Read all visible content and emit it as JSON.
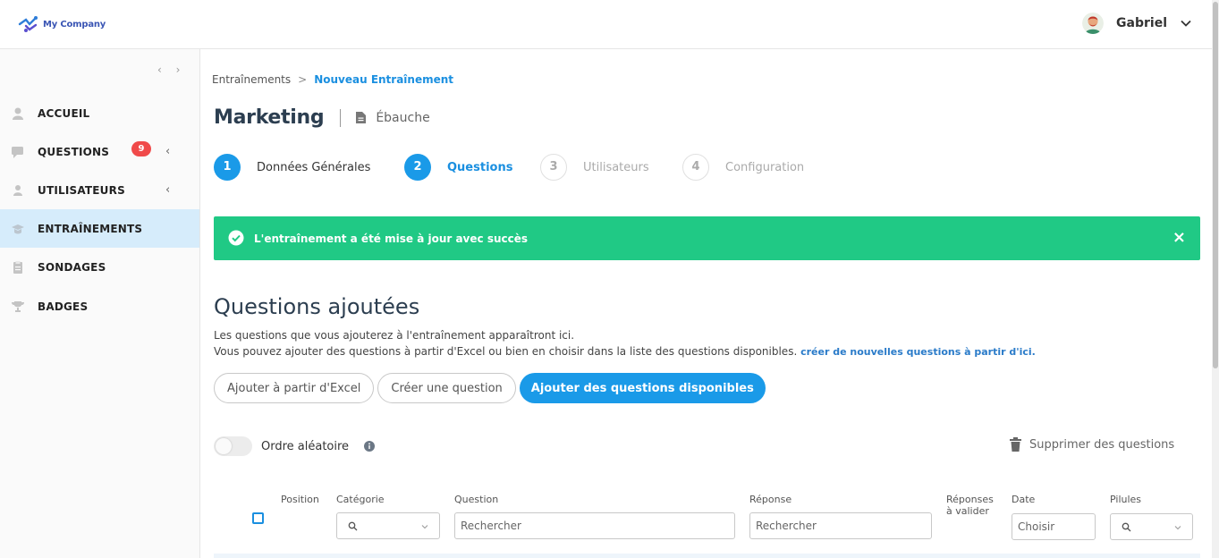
{
  "header": {
    "logo_text": "My Company",
    "user_name": "Gabriel"
  },
  "sidebar": {
    "collapse_glyph": "‹ ›",
    "items": [
      {
        "label": "ACCUEIL",
        "icon": "home-icon"
      },
      {
        "label": "QUESTIONS",
        "icon": "chat-icon",
        "badge": "9"
      },
      {
        "label": "UTILISATEURS",
        "icon": "user-icon"
      },
      {
        "label": "ENTRAÎNEMENTS",
        "icon": "graduation-cap-icon",
        "active": true
      },
      {
        "label": "SONDAGES",
        "icon": "clipboard-icon"
      },
      {
        "label": "BADGES",
        "icon": "trophy-icon"
      }
    ]
  },
  "breadcrumb": {
    "parent": "Entraînements",
    "separator": ">",
    "current": "Nouveau Entraînement"
  },
  "page": {
    "title": "Marketing",
    "status": "Ébauche"
  },
  "steps": [
    {
      "number": "1",
      "label": "Données Générales",
      "state": "done"
    },
    {
      "number": "2",
      "label": "Questions",
      "state": "current"
    },
    {
      "number": "3",
      "label": "Utilisateurs",
      "state": "todo"
    },
    {
      "number": "4",
      "label": "Configuration",
      "state": "todo"
    }
  ],
  "alert": {
    "message": "L'entraînement a été mise à jour avec succès",
    "close": "×"
  },
  "section": {
    "title": "Questions ajoutées",
    "desc1": "Les questions que vous ajouterez à l'entraînement apparaîtront ici.",
    "desc2": "Vous pouvez ajouter des questions à partir d'Excel ou bien en choisir dans la liste des questions disponibles.",
    "link": "créer de nouvelles questions à partir d'ici."
  },
  "buttons": {
    "excel": "Ajouter à partir d'Excel",
    "create": "Créer une question",
    "add": "Ajouter des questions disponibles"
  },
  "options": {
    "random_label": "Ordre aléatoire",
    "delete_label": "Supprimer des questions"
  },
  "table": {
    "columns": {
      "position": "Position",
      "category": "Catégorie",
      "question": "Question",
      "answer": "Réponse",
      "to_validate_1": "Réponses",
      "to_validate_2": "à valider",
      "date": "Date",
      "pills": "Pilules"
    },
    "placeholders": {
      "question": "Rechercher",
      "answer": "Rechercher",
      "date": "Choisir"
    }
  },
  "colors": {
    "primary": "#1a9ae8",
    "success": "#20c985",
    "badge": "#f04a4a",
    "active_nav": "#d6ecfb"
  }
}
